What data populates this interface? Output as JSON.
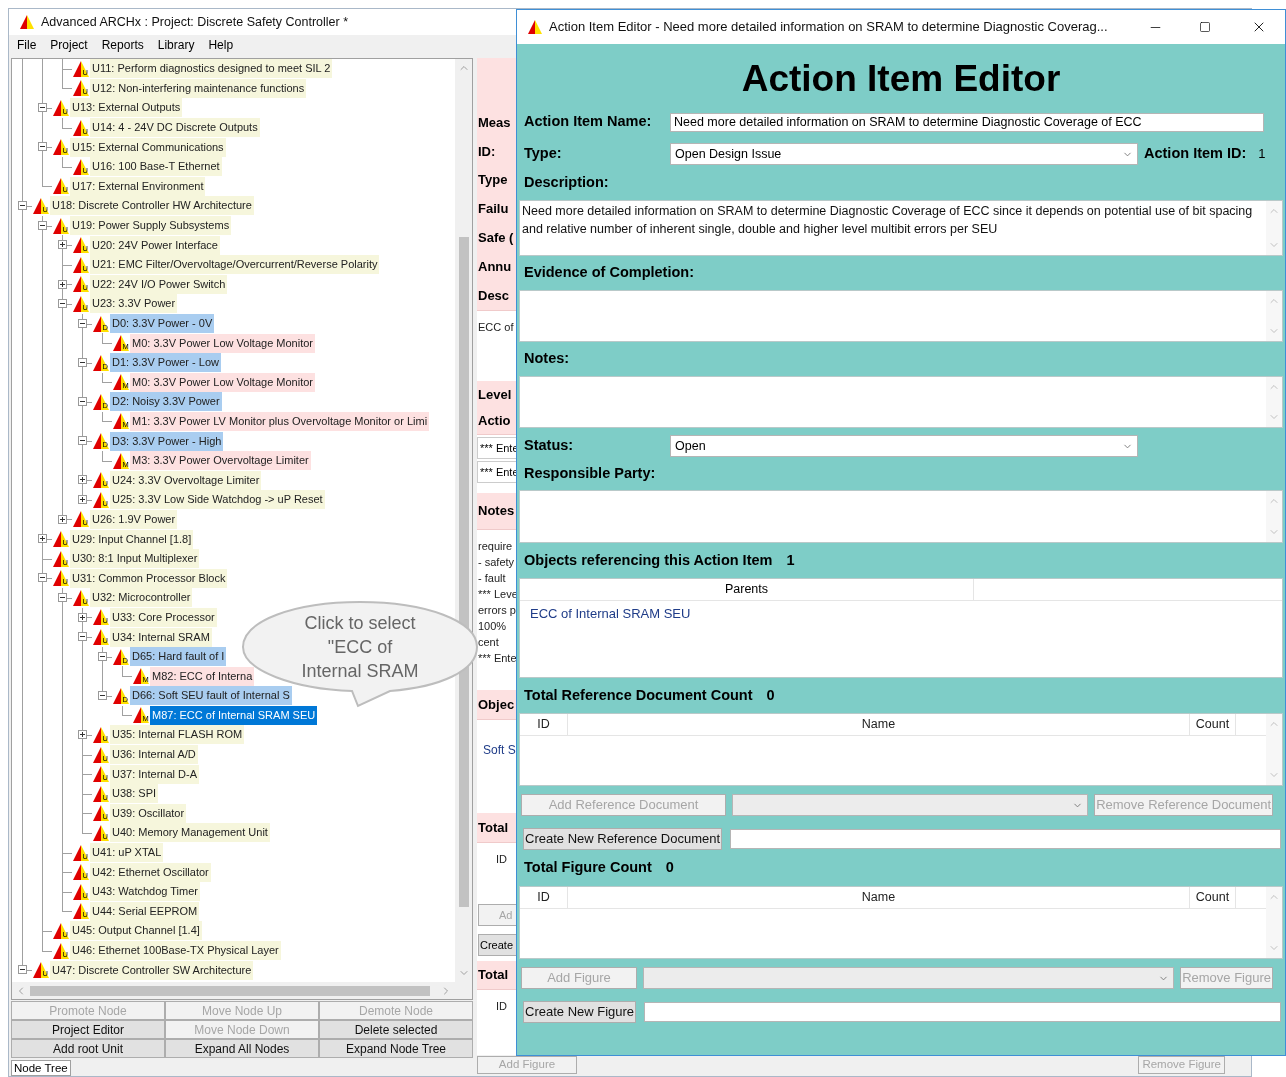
{
  "main_window": {
    "title": "Advanced ARCHx : Project: Discrete Safety Controller *",
    "menu": [
      "File",
      "Project",
      "Reports",
      "Library",
      "Help"
    ],
    "tree": [
      {
        "children": [
          {
            "children": [
              {
                "badge": "U",
                "label": "U11: Perform diagnostics designed to meet SIL 2",
                "kind": "unit",
                "selected": false
              },
              {
                "badge": "U",
                "label": "U12: Non-interfering maintenance functions",
                "kind": "unit",
                "selected": false
              }
            ]
          },
          {
            "badge": "U",
            "label": "U13: External Outputs",
            "kind": "unit",
            "selected": false,
            "expanded": true,
            "children": [
              {
                "badge": "U",
                "label": "U14: 4 - 24V DC Discrete Outputs",
                "kind": "unit",
                "selected": false
              }
            ]
          },
          {
            "badge": "U",
            "label": "U15: External Communications",
            "kind": "unit",
            "selected": false,
            "expanded": true,
            "children": [
              {
                "badge": "U",
                "label": "U16: 100 Base-T Ethernet",
                "kind": "unit",
                "selected": false
              }
            ]
          },
          {
            "badge": "U",
            "label": "U17: External Environment",
            "kind": "unit",
            "selected": false
          }
        ]
      },
      {
        "badge": "U",
        "label": "U18: Discrete Controller HW Architecture",
        "kind": "unit",
        "selected": false,
        "expanded": true,
        "children": [
          {
            "badge": "U",
            "label": "U19: Power Supply Subsystems",
            "kind": "unit",
            "selected": false,
            "expanded": true,
            "children": [
              {
                "badge": "U",
                "label": "U20: 24V Power Interface",
                "kind": "unit",
                "selected": false,
                "expanded": false
              },
              {
                "badge": "U",
                "label": "U21: EMC Filter/Overvoltage/Overcurrent/Reverse Polarity",
                "kind": "unit",
                "selected": false
              },
              {
                "badge": "U",
                "label": "U22: 24V I/O Power Switch",
                "kind": "unit",
                "selected": false,
                "expanded": false
              },
              {
                "badge": "U",
                "label": "U23: 3.3V Power",
                "kind": "unit",
                "selected": false,
                "expanded": true,
                "children": [
                  {
                    "badge": "D",
                    "label": "D0: 3.3V Power - 0V",
                    "kind": "fault",
                    "selected": false,
                    "expanded": true,
                    "children": [
                      {
                        "badge": "M",
                        "label": "M0: 3.3V Power Low Voltage Monitor",
                        "kind": "measure",
                        "selected": false
                      }
                    ]
                  },
                  {
                    "badge": "D",
                    "label": "D1: 3.3V Power - Low",
                    "kind": "fault",
                    "selected": false,
                    "expanded": true,
                    "children": [
                      {
                        "badge": "M",
                        "label": "M0: 3.3V Power Low Voltage Monitor",
                        "kind": "measure",
                        "selected": false
                      }
                    ]
                  },
                  {
                    "badge": "D",
                    "label": "D2: Noisy 3.3V Power",
                    "kind": "fault",
                    "selected": false,
                    "expanded": true,
                    "children": [
                      {
                        "badge": "M",
                        "label": "M1: 3.3V Power LV Monitor plus Overvoltage Monitor or Limi",
                        "kind": "measure",
                        "selected": false
                      }
                    ]
                  },
                  {
                    "badge": "D",
                    "label": "D3: 3.3V Power - High",
                    "kind": "fault",
                    "selected": false,
                    "expanded": true,
                    "children": [
                      {
                        "badge": "M",
                        "label": "M3: 3.3V Power Overvoltage Limiter",
                        "kind": "measure",
                        "selected": false
                      }
                    ]
                  },
                  {
                    "badge": "U",
                    "label": "U24: 3.3V Overvoltage Limiter",
                    "kind": "unit",
                    "selected": false,
                    "expanded": false
                  },
                  {
                    "badge": "U",
                    "label": "U25: 3.3V Low Side Watchdog -> uP Reset",
                    "kind": "unit",
                    "selected": false,
                    "expanded": false
                  }
                ]
              },
              {
                "badge": "U",
                "label": "U26: 1.9V Power",
                "kind": "unit",
                "selected": false,
                "expanded": false
              }
            ]
          },
          {
            "badge": "U",
            "label": "U29: Input Channel [1.8]",
            "kind": "unit",
            "selected": false,
            "expanded": false
          },
          {
            "badge": "U",
            "label": "U30: 8:1 Input Multiplexer",
            "kind": "unit",
            "selected": false
          },
          {
            "badge": "U",
            "label": "U31: Common Processor Block",
            "kind": "unit",
            "selected": false,
            "expanded": true,
            "children": [
              {
                "badge": "U",
                "label": "U32: Microcontroller",
                "kind": "unit",
                "selected": false,
                "expanded": true,
                "children": [
                  {
                    "badge": "U",
                    "label": "U33: Core Processor",
                    "kind": "unit",
                    "selected": false,
                    "expanded": false
                  },
                  {
                    "badge": "U",
                    "label": "U34: Internal SRAM",
                    "kind": "unit",
                    "selected": false,
                    "expanded": true,
                    "children": [
                      {
                        "badge": "D",
                        "label": "D65: Hard fault of I",
                        "kind": "fault",
                        "selected": false,
                        "expanded": true,
                        "children": [
                          {
                            "badge": "M",
                            "label": "M82: ECC of Interna",
                            "kind": "measure",
                            "selected": false
                          }
                        ]
                      },
                      {
                        "badge": "D",
                        "label": "D66: Soft SEU fault of Internal S",
                        "kind": "fault",
                        "selected": false,
                        "expanded": true,
                        "children": [
                          {
                            "badge": "M",
                            "label": "M87: ECC of Internal SRAM SEU",
                            "kind": "measure",
                            "selected": true
                          }
                        ]
                      }
                    ]
                  },
                  {
                    "badge": "U",
                    "label": "U35: Internal FLASH ROM",
                    "kind": "unit",
                    "selected": false,
                    "expanded": false
                  },
                  {
                    "badge": "U",
                    "label": "U36: Internal A/D",
                    "kind": "unit",
                    "selected": false
                  },
                  {
                    "badge": "U",
                    "label": "U37: Internal D-A",
                    "kind": "unit",
                    "selected": false
                  },
                  {
                    "badge": "U",
                    "label": "U38: SPI",
                    "kind": "unit",
                    "selected": false
                  },
                  {
                    "badge": "U",
                    "label": "U39: Oscillator",
                    "kind": "unit",
                    "selected": false
                  },
                  {
                    "badge": "U",
                    "label": "U40: Memory Management Unit",
                    "kind": "unit",
                    "selected": false
                  }
                ]
              },
              {
                "badge": "U",
                "label": "U41: uP XTAL",
                "kind": "unit",
                "selected": false
              },
              {
                "badge": "U",
                "label": "U42: Ethernet Oscillator",
                "kind": "unit",
                "selected": false
              },
              {
                "badge": "U",
                "label": "U43: Watchdog Timer",
                "kind": "unit",
                "selected": false
              },
              {
                "badge": "U",
                "label": "U44: Serial EEPROM",
                "kind": "unit",
                "selected": false
              }
            ]
          },
          {
            "badge": "U",
            "label": "U45: Output Channel [1.4]",
            "kind": "unit",
            "selected": false
          },
          {
            "badge": "U",
            "label": "U46: Ethernet 100Base-TX Physical Layer",
            "kind": "unit",
            "selected": false
          }
        ]
      },
      {
        "badge": "U",
        "label": "U47: Discrete Controller SW Architecture",
        "kind": "unit",
        "selected": false,
        "expanded": true
      }
    ],
    "callout": {
      "text": "Click to select \"ECC of Internal SRAM"
    },
    "tree_buttons": [
      {
        "label": "Promote Node",
        "disabled": true
      },
      {
        "label": "Move Node Up",
        "disabled": true
      },
      {
        "label": "Demote Node",
        "disabled": true
      },
      {
        "label": "Project Editor",
        "disabled": false
      },
      {
        "label": "Move Node Down",
        "disabled": true
      },
      {
        "label": "Delete selected",
        "disabled": false
      },
      {
        "label": "Add root Unit",
        "disabled": false
      },
      {
        "label": "Expand All Nodes",
        "disabled": false
      },
      {
        "label": "Expand Node Tree",
        "disabled": false
      }
    ],
    "status_tab": "Node Tree",
    "behind_panel": {
      "sections": [
        {
          "kind": "band",
          "lines": [
            "Meas",
            "ID:",
            "Type",
            "Failu",
            "Safe (",
            "Annu",
            "Desc"
          ]
        },
        {
          "kind": "text",
          "lines": [
            "ECC of"
          ]
        },
        {
          "kind": "band",
          "lines": [
            "Level",
            "Actio"
          ]
        },
        {
          "kind": "fields",
          "lines": [
            "*** Ente",
            "*** Ente"
          ]
        },
        {
          "kind": "band",
          "lines": [
            "Notes"
          ]
        },
        {
          "kind": "text",
          "lines": [
            "require",
            "- safety",
            "- fault",
            "*** Leve",
            "errors p",
            "100%",
            "cent",
            "*** Ente"
          ]
        },
        {
          "kind": "band",
          "lines": [
            "Objec"
          ]
        },
        {
          "kind": "links",
          "lines": [
            "Soft S"
          ]
        },
        {
          "kind": "band",
          "lines": [
            "Total"
          ]
        },
        {
          "kind": "text",
          "lines": [
            "ID"
          ]
        },
        {
          "kind": "buttons",
          "lines": [
            "Ad",
            "Create"
          ]
        },
        {
          "kind": "band",
          "lines": [
            "Total"
          ]
        },
        {
          "kind": "text",
          "lines": [
            "ID"
          ]
        }
      ],
      "bottom_row": {
        "add_button": "Add Figure",
        "remove_button": "Remove Figure"
      }
    }
  },
  "dialog": {
    "title": "Action Item Editor - Need more detailed information on SRAM to determine Diagnostic Coverag...",
    "heading": "Action Item Editor",
    "name": {
      "label": "Action Item Name:",
      "value": "Need more detailed information on SRAM to determine Diagnostic Coverage of ECC"
    },
    "type": {
      "label": "Type:",
      "value": "Open Design Issue"
    },
    "item_id": {
      "label": "Action Item ID:",
      "value": "1"
    },
    "description": {
      "label": "Description:",
      "value": "Need more detailed information on SRAM to determine Diagnostic Coverage of ECC since it depends on potential use of bit spacing and relative number of inherent single, double and higher level multibit errors per SEU"
    },
    "evidence": {
      "label": "Evidence of Completion:"
    },
    "notes": {
      "label": "Notes:"
    },
    "status": {
      "label": "Status:",
      "value": "Open"
    },
    "responsible": {
      "label": "Responsible Party:"
    },
    "referencing": {
      "title": "Objects referencing this Action Item",
      "count": "1",
      "columns": [
        "Parents"
      ],
      "rows": [
        "ECC of Internal SRAM SEU"
      ]
    },
    "reference_documents": {
      "title": "Total Reference Document Count",
      "count": "0",
      "columns": [
        "ID",
        "Name",
        "Count"
      ],
      "add_button": {
        "label": "Add Reference Document",
        "disabled": true
      },
      "remove_button": {
        "label": "Remove Reference Document",
        "disabled": true
      },
      "create_button": {
        "label": "Create New Reference Document",
        "disabled": false
      }
    },
    "figures": {
      "title": "Total Figure Count",
      "count": "0",
      "columns": [
        "ID",
        "Name",
        "Count"
      ],
      "add_button": {
        "label": "Add Figure",
        "disabled": true
      },
      "remove_button": {
        "label": "Remove Figure",
        "disabled": true
      },
      "create_button": {
        "label": "Create New Figure",
        "disabled": false
      }
    }
  }
}
